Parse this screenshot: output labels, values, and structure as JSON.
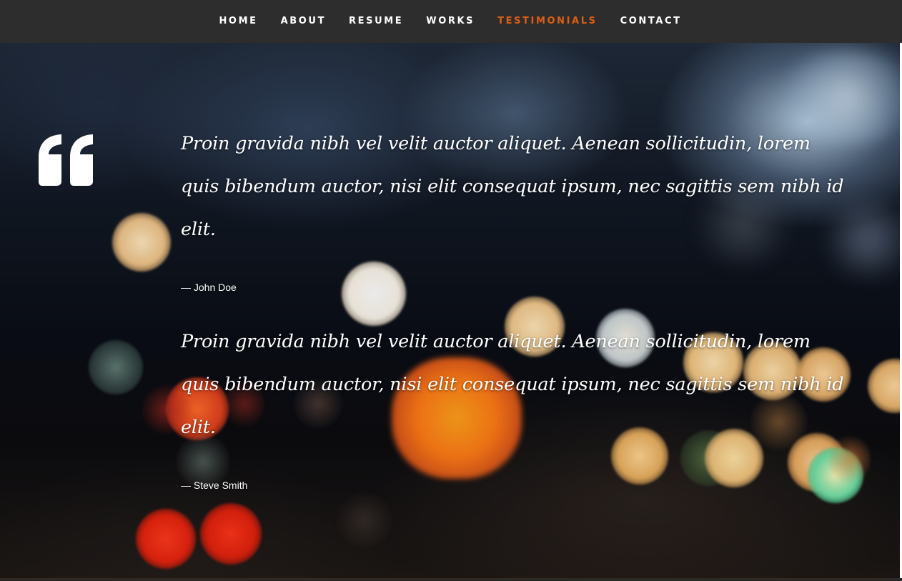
{
  "nav": {
    "items": [
      {
        "label": "HOME",
        "active": false
      },
      {
        "label": "ABOUT",
        "active": false
      },
      {
        "label": "RESUME",
        "active": false
      },
      {
        "label": "WORKS",
        "active": false
      },
      {
        "label": "TESTIMONIALS",
        "active": true
      },
      {
        "label": "CONTACT",
        "active": false
      }
    ],
    "active_color": "#dd5e13",
    "background_color": "#2d2d2d"
  },
  "testimonials": {
    "icon": "quote-icon",
    "items": [
      {
        "text": "Proin gravida nibh vel velit auctor aliquet. Aenean sollicitudin, lorem quis bibendum auctor, nisi elit consequat ipsum, nec sagittis sem nibh id elit.",
        "author": "— John Doe"
      },
      {
        "text": "Proin gravida nibh vel velit auctor aliquet. Aenean sollicitudin, lorem quis bibendum auctor, nisi elit consequat ipsum, nec sagittis sem nibh id elit.",
        "author": "— Steve Smith"
      }
    ]
  },
  "background": {
    "description_icon": "bokeh-lights-background"
  }
}
